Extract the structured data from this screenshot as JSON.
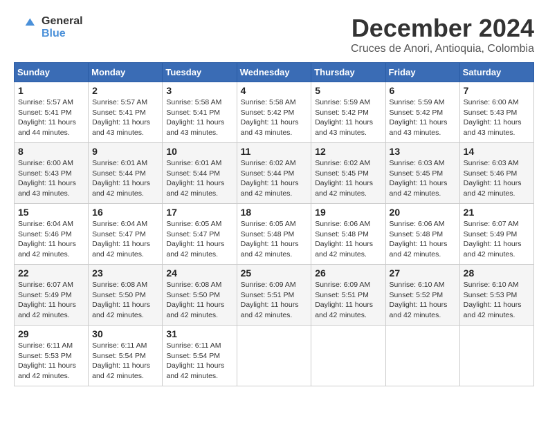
{
  "header": {
    "logo_line1": "General",
    "logo_line2": "Blue",
    "month": "December 2024",
    "location": "Cruces de Anori, Antioquia, Colombia"
  },
  "weekdays": [
    "Sunday",
    "Monday",
    "Tuesday",
    "Wednesday",
    "Thursday",
    "Friday",
    "Saturday"
  ],
  "weeks": [
    [
      {
        "day": "1",
        "info": "Sunrise: 5:57 AM\nSunset: 5:41 PM\nDaylight: 11 hours\nand 44 minutes."
      },
      {
        "day": "2",
        "info": "Sunrise: 5:57 AM\nSunset: 5:41 PM\nDaylight: 11 hours\nand 43 minutes."
      },
      {
        "day": "3",
        "info": "Sunrise: 5:58 AM\nSunset: 5:41 PM\nDaylight: 11 hours\nand 43 minutes."
      },
      {
        "day": "4",
        "info": "Sunrise: 5:58 AM\nSunset: 5:42 PM\nDaylight: 11 hours\nand 43 minutes."
      },
      {
        "day": "5",
        "info": "Sunrise: 5:59 AM\nSunset: 5:42 PM\nDaylight: 11 hours\nand 43 minutes."
      },
      {
        "day": "6",
        "info": "Sunrise: 5:59 AM\nSunset: 5:42 PM\nDaylight: 11 hours\nand 43 minutes."
      },
      {
        "day": "7",
        "info": "Sunrise: 6:00 AM\nSunset: 5:43 PM\nDaylight: 11 hours\nand 43 minutes."
      }
    ],
    [
      {
        "day": "8",
        "info": "Sunrise: 6:00 AM\nSunset: 5:43 PM\nDaylight: 11 hours\nand 43 minutes."
      },
      {
        "day": "9",
        "info": "Sunrise: 6:01 AM\nSunset: 5:44 PM\nDaylight: 11 hours\nand 42 minutes."
      },
      {
        "day": "10",
        "info": "Sunrise: 6:01 AM\nSunset: 5:44 PM\nDaylight: 11 hours\nand 42 minutes."
      },
      {
        "day": "11",
        "info": "Sunrise: 6:02 AM\nSunset: 5:44 PM\nDaylight: 11 hours\nand 42 minutes."
      },
      {
        "day": "12",
        "info": "Sunrise: 6:02 AM\nSunset: 5:45 PM\nDaylight: 11 hours\nand 42 minutes."
      },
      {
        "day": "13",
        "info": "Sunrise: 6:03 AM\nSunset: 5:45 PM\nDaylight: 11 hours\nand 42 minutes."
      },
      {
        "day": "14",
        "info": "Sunrise: 6:03 AM\nSunset: 5:46 PM\nDaylight: 11 hours\nand 42 minutes."
      }
    ],
    [
      {
        "day": "15",
        "info": "Sunrise: 6:04 AM\nSunset: 5:46 PM\nDaylight: 11 hours\nand 42 minutes."
      },
      {
        "day": "16",
        "info": "Sunrise: 6:04 AM\nSunset: 5:47 PM\nDaylight: 11 hours\nand 42 minutes."
      },
      {
        "day": "17",
        "info": "Sunrise: 6:05 AM\nSunset: 5:47 PM\nDaylight: 11 hours\nand 42 minutes."
      },
      {
        "day": "18",
        "info": "Sunrise: 6:05 AM\nSunset: 5:48 PM\nDaylight: 11 hours\nand 42 minutes."
      },
      {
        "day": "19",
        "info": "Sunrise: 6:06 AM\nSunset: 5:48 PM\nDaylight: 11 hours\nand 42 minutes."
      },
      {
        "day": "20",
        "info": "Sunrise: 6:06 AM\nSunset: 5:48 PM\nDaylight: 11 hours\nand 42 minutes."
      },
      {
        "day": "21",
        "info": "Sunrise: 6:07 AM\nSunset: 5:49 PM\nDaylight: 11 hours\nand 42 minutes."
      }
    ],
    [
      {
        "day": "22",
        "info": "Sunrise: 6:07 AM\nSunset: 5:49 PM\nDaylight: 11 hours\nand 42 minutes."
      },
      {
        "day": "23",
        "info": "Sunrise: 6:08 AM\nSunset: 5:50 PM\nDaylight: 11 hours\nand 42 minutes."
      },
      {
        "day": "24",
        "info": "Sunrise: 6:08 AM\nSunset: 5:50 PM\nDaylight: 11 hours\nand 42 minutes."
      },
      {
        "day": "25",
        "info": "Sunrise: 6:09 AM\nSunset: 5:51 PM\nDaylight: 11 hours\nand 42 minutes."
      },
      {
        "day": "26",
        "info": "Sunrise: 6:09 AM\nSunset: 5:51 PM\nDaylight: 11 hours\nand 42 minutes."
      },
      {
        "day": "27",
        "info": "Sunrise: 6:10 AM\nSunset: 5:52 PM\nDaylight: 11 hours\nand 42 minutes."
      },
      {
        "day": "28",
        "info": "Sunrise: 6:10 AM\nSunset: 5:53 PM\nDaylight: 11 hours\nand 42 minutes."
      }
    ],
    [
      {
        "day": "29",
        "info": "Sunrise: 6:11 AM\nSunset: 5:53 PM\nDaylight: 11 hours\nand 42 minutes."
      },
      {
        "day": "30",
        "info": "Sunrise: 6:11 AM\nSunset: 5:54 PM\nDaylight: 11 hours\nand 42 minutes."
      },
      {
        "day": "31",
        "info": "Sunrise: 6:11 AM\nSunset: 5:54 PM\nDaylight: 11 hours\nand 42 minutes."
      },
      null,
      null,
      null,
      null
    ]
  ]
}
